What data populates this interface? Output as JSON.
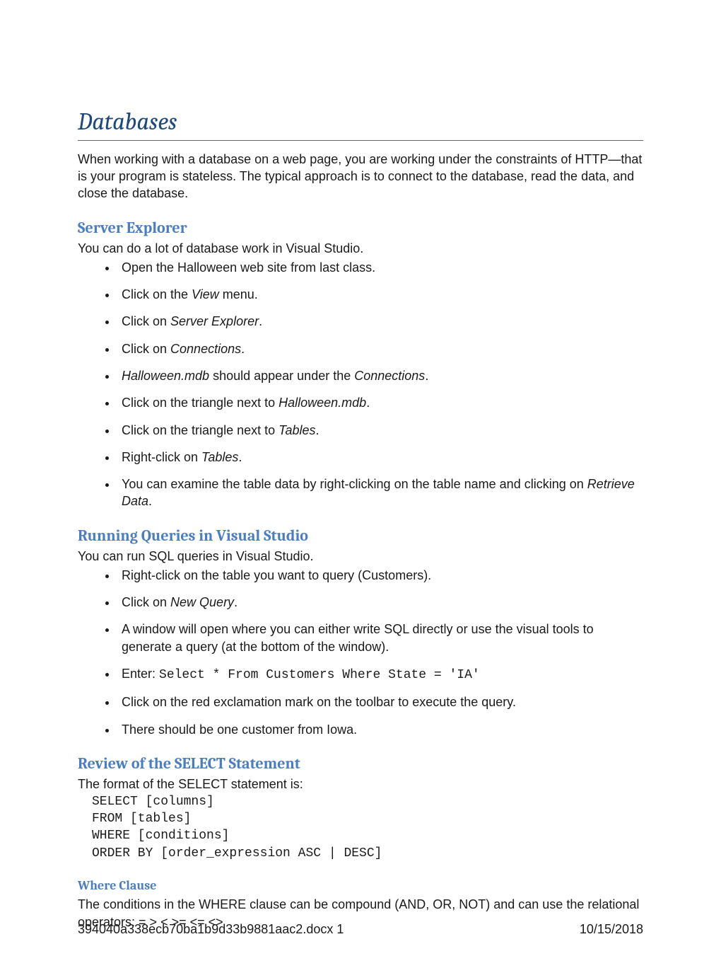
{
  "title": "Databases",
  "intro": "When working with a database on a web page, you are working under the constraints of HTTP—that is your program is stateless. The typical approach is to connect to the database, read the data, and close the database.",
  "section1": {
    "heading": "Server Explorer",
    "lead": "You can do a lot of database work in Visual Studio.",
    "b1": "Open the Halloween web site from last class.",
    "b2a": "Click on the ",
    "b2b": "View",
    "b2c": " menu.",
    "b3a": "Click on ",
    "b3b": "Server Explorer",
    "b3c": ".",
    "b4a": "Click on ",
    "b4b": "Connections",
    "b4c": ".",
    "b5a": "Halloween.mdb",
    "b5b": " should appear under the ",
    "b5c": "Connections",
    "b5d": ".",
    "b6a": "Click on the triangle next to ",
    "b6b": "Halloween.mdb",
    "b6c": ".",
    "b7a": "Click on the triangle next to ",
    "b7b": "Tables",
    "b7c": ".",
    "b8a": "Right-click on ",
    "b8b": "Tables",
    "b8c": ".",
    "b9a": "You can examine the table data by right-clicking on the table name and clicking on ",
    "b9b": "Retrieve Data",
    "b9c": "."
  },
  "section2": {
    "heading": "Running Queries in Visual Studio",
    "lead": "You can run SQL queries in Visual Studio.",
    "b1": "Right-click on the table you want to query (Customers).",
    "b2a": "Click on ",
    "b2b": "New Query",
    "b2c": ".",
    "b3": "A window will open where you can either write SQL directly or use the visual tools to generate a query (at the bottom of the window).",
    "b4a": "Enter: ",
    "b4b": "Select * From Customers Where State = 'IA'",
    "b5": "Click on the red exclamation mark on the toolbar to execute the query.",
    "b6": "There should be one customer from Iowa."
  },
  "section3": {
    "heading": "Review of the SELECT Statement",
    "lead": "The format of the SELECT statement is:",
    "code": "SELECT [columns]\nFROM [tables]\nWHERE [conditions]\nORDER BY [order_expression ASC | DESC]",
    "sub1": {
      "heading": "Where Clause",
      "text": "The conditions in the WHERE clause can be compound (AND, OR, NOT) and can use the relational operators: =   >   <   >=   <=   <>"
    }
  },
  "footer": {
    "left": "394040a338ecb70ba1b9d33b9881aac2.docx  1",
    "right": "10/15/2018"
  }
}
